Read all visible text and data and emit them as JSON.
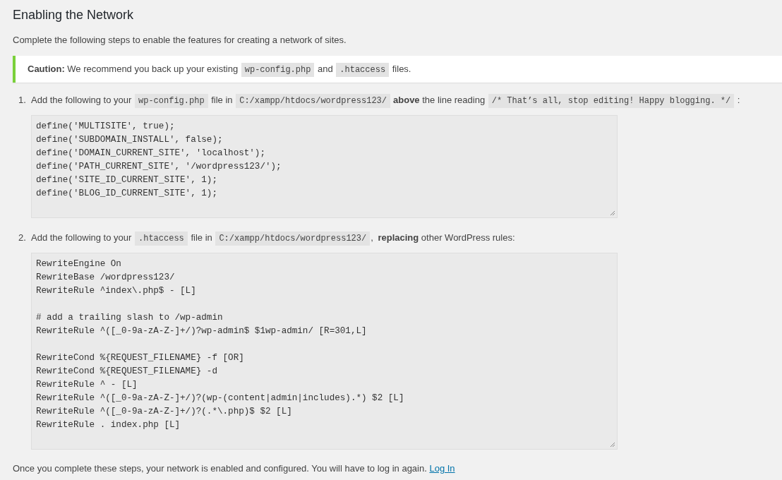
{
  "heading": "Enabling the Network",
  "intro": "Complete the following steps to enable the features for creating a network of sites.",
  "caution": [
    {
      "kind": "bold",
      "text": "Caution:"
    },
    {
      "kind": "text",
      "text": " We recommend you back up your existing "
    },
    {
      "kind": "code",
      "text": "wp-config.php"
    },
    {
      "kind": "text",
      "text": " and "
    },
    {
      "kind": "code",
      "text": ".htaccess"
    },
    {
      "kind": "text",
      "text": " files."
    }
  ],
  "steps": [
    {
      "number": "1.",
      "parts": [
        {
          "kind": "text",
          "text": "Add the following to your "
        },
        {
          "kind": "code",
          "text": "wp-config.php"
        },
        {
          "kind": "text",
          "text": " file in "
        },
        {
          "kind": "code",
          "text": "C:/xampp/htdocs/wordpress123/"
        },
        {
          "kind": "bold",
          "text": "above"
        },
        {
          "kind": "text",
          "text": " the line reading "
        },
        {
          "kind": "code",
          "text": "/* That’s all, stop editing! Happy blogging. */"
        },
        {
          "kind": "text",
          "text": " :"
        }
      ],
      "code": "define('MULTISITE', true);\ndefine('SUBDOMAIN_INSTALL', false);\ndefine('DOMAIN_CURRENT_SITE', 'localhost');\ndefine('PATH_CURRENT_SITE', '/wordpress123/');\ndefine('SITE_ID_CURRENT_SITE', 1);\ndefine('BLOG_ID_CURRENT_SITE', 1);"
    },
    {
      "number": "2.",
      "parts": [
        {
          "kind": "text",
          "text": "Add the following to your "
        },
        {
          "kind": "code",
          "text": ".htaccess"
        },
        {
          "kind": "text",
          "text": " file in "
        },
        {
          "kind": "code",
          "text": "C:/xampp/htdocs/wordpress123/"
        },
        {
          "kind": "text",
          "text": ", "
        },
        {
          "kind": "bold",
          "text": "replacing"
        },
        {
          "kind": "text",
          "text": " other WordPress rules:"
        }
      ],
      "code": "RewriteEngine On\nRewriteBase /wordpress123/\nRewriteRule ^index\\.php$ - [L]\n\n# add a trailing slash to /wp-admin\nRewriteRule ^([_0-9a-zA-Z-]+/)?wp-admin$ $1wp-admin/ [R=301,L]\n\nRewriteCond %{REQUEST_FILENAME} -f [OR]\nRewriteCond %{REQUEST_FILENAME} -d\nRewriteRule ^ - [L]\nRewriteRule ^([_0-9a-zA-Z-]+/)?(wp-(content|admin|includes).*) $2 [L]\nRewriteRule ^([_0-9a-zA-Z-]+/)?(.*\\.php)$ $2 [L]\nRewriteRule . index.php [L]"
    }
  ],
  "footer": {
    "text": "Once you complete these steps, your network is enabled and configured. You will have to log in again.",
    "link": "Log In"
  }
}
